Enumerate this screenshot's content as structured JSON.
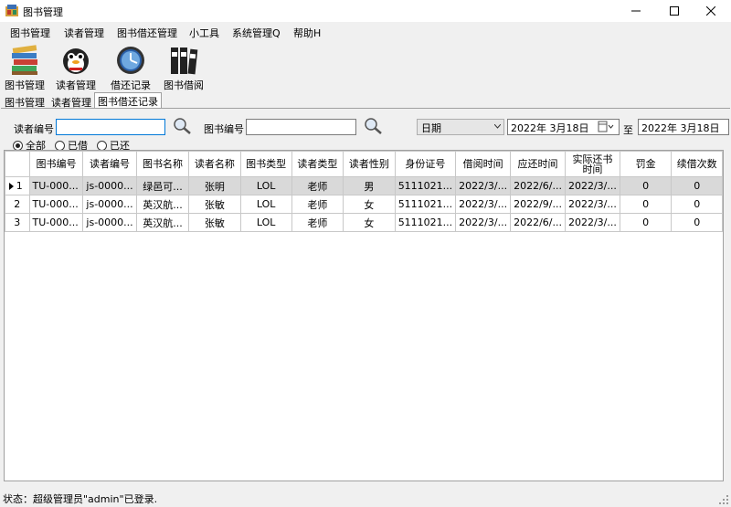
{
  "window": {
    "title": "图书管理"
  },
  "menu": [
    "图书管理",
    "读者管理",
    "图书借还管理",
    "小工具",
    "系统管理Q",
    "帮助H"
  ],
  "toolbar": [
    {
      "label": "图书管理",
      "icon": "books-icon"
    },
    {
      "label": "读者管理",
      "icon": "reader-icon"
    },
    {
      "label": "借还记录",
      "icon": "clock-icon"
    },
    {
      "label": "图书借阅",
      "icon": "binders-icon"
    }
  ],
  "tabs": [
    "图书管理",
    "读者管理",
    "图书借还记录"
  ],
  "search": {
    "reader_label": "读者编号",
    "reader_value": "",
    "book_label": "图书编号",
    "book_value": "",
    "date_type": "日期",
    "date_from": "2022年  3月18日",
    "to_label": "至",
    "date_to": "2022年  3月18日"
  },
  "filter": {
    "all": "全部",
    "borrowed": "已借",
    "returned": "已还",
    "selected": "all"
  },
  "grid": {
    "columns": [
      "图书编号",
      "读者编号",
      "图书名称",
      "读者名称",
      "图书类型",
      "读者类型",
      "读者性别",
      "身份证号",
      "借阅时间",
      "应还时间",
      "实际还书时间",
      "罚金",
      "续借次数"
    ],
    "rows": [
      {
        "num": "1",
        "cells": [
          "TU-000...",
          "js-0000...",
          "绿邑可...",
          "张明",
          "LOL",
          "老师",
          "男",
          "5111021...",
          "2022/3/...",
          "2022/6/...",
          "2022/3/...",
          "0",
          "0"
        ]
      },
      {
        "num": "2",
        "cells": [
          "TU-000...",
          "js-0000...",
          "英汉航...",
          "张敏",
          "LOL",
          "老师",
          "女",
          "5111021...",
          "2022/3/...",
          "2022/9/...",
          "2022/3/...",
          "0",
          "0"
        ]
      },
      {
        "num": "3",
        "cells": [
          "TU-000...",
          "js-0000...",
          "英汉航...",
          "张敏",
          "LOL",
          "老师",
          "女",
          "5111021...",
          "2022/3/...",
          "2022/6/...",
          "2022/3/...",
          "0",
          "0"
        ]
      }
    ],
    "selected_row": 0
  },
  "status": {
    "text": "状态：超级管理员\"admin\"已登录."
  }
}
